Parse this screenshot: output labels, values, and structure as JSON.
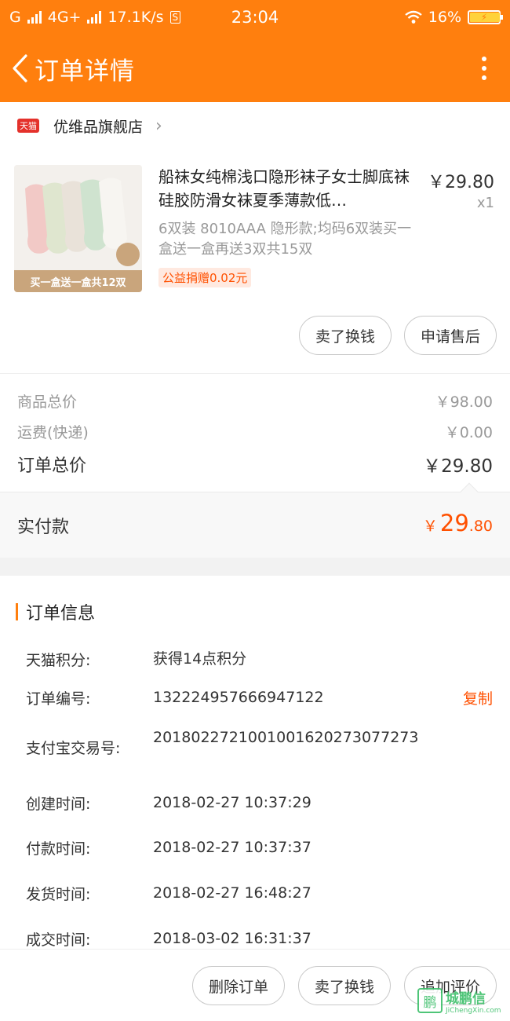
{
  "status_bar": {
    "carrier": "G",
    "network": "4G+",
    "speed": "17.1K/s",
    "s_icon": "S",
    "time": "23:04",
    "battery": "16%"
  },
  "nav": {
    "title": "订单详情"
  },
  "shop": {
    "badge": "天猫",
    "name": "优维品旗舰店"
  },
  "product": {
    "title": "船袜女纯棉浅口隐形袜子女士脚底袜硅胶防滑女袜夏季薄款低…",
    "price": "￥29.80",
    "quantity": "x1",
    "spec": "6双装 8010AAA 隐形款;均码6双装买一盒送一盒再送3双共15双",
    "charity_badge": "公益捐赠0.02元",
    "thumb_caption": "买一盒送一盒共12双"
  },
  "product_actions": {
    "sell": "卖了换钱",
    "after_sales": "申请售后"
  },
  "summary": {
    "goods_label": "商品总价",
    "goods_value": "￥98.00",
    "shipping_label": "运费(快递)",
    "shipping_value": "￥0.00",
    "total_label": "订单总价",
    "total_value": "￥29.80",
    "paid_label": "实付款",
    "paid_yen": "￥",
    "paid_int": "29",
    "paid_dec": ".80"
  },
  "order_info": {
    "section_title": "订单信息",
    "rows": [
      {
        "label": "天猫积分:",
        "value": "获得14点积分"
      },
      {
        "label": "订单编号:",
        "value": "132224957666947122"
      },
      {
        "label": "支付宝交易号:",
        "value": "2018022721001001620273077273"
      },
      {
        "label": "创建时间:",
        "value": "2018-02-27 10:37:29"
      },
      {
        "label": "付款时间:",
        "value": "2018-02-27 10:37:37"
      },
      {
        "label": "发货时间:",
        "value": "2018-02-27 16:48:27"
      },
      {
        "label": "成交时间:",
        "value": "2018-03-02 16:31:37"
      }
    ],
    "copy_label": "复制"
  },
  "bottom_actions": {
    "delete": "删除订单",
    "sell": "卖了换钱",
    "review": "追加评价"
  },
  "watermark": {
    "logo": "鹏",
    "cn": "城鹏信",
    "en": "JiChengXin.com"
  },
  "colors": {
    "brand_orange": "#ff7f0e",
    "price_red": "#ff5000",
    "tmall_red": "#e4312b"
  }
}
